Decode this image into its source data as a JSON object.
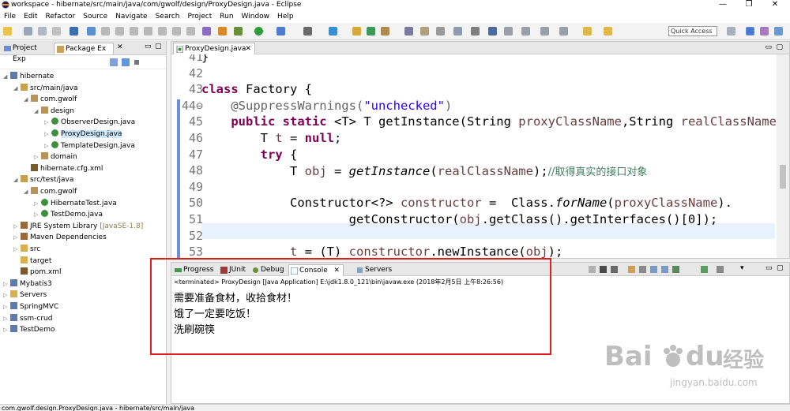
{
  "window": {
    "title": "workspace - hibernate/src/main/java/com/gwolf/design/ProxyDesign.java - Eclipse",
    "minimize": "—",
    "restore": "❐",
    "close": "✕"
  },
  "menu": [
    "File",
    "Edit",
    "Refactor",
    "Source",
    "Navigate",
    "Search",
    "Project",
    "Run",
    "Window",
    "Help"
  ],
  "quick_access": "Quick Access",
  "left_tabs": {
    "project_explorer": "Project Exp",
    "package_explorer": "Package Ex"
  },
  "tree": [
    {
      "label": "hibernate",
      "indent": 0,
      "arrow": "◢",
      "icon": "project"
    },
    {
      "label": "src/main/java",
      "indent": 1,
      "arrow": "◢",
      "icon": "srcfolder"
    },
    {
      "label": "com.gwolf",
      "indent": 2,
      "arrow": "◢",
      "icon": "package"
    },
    {
      "label": "design",
      "indent": 3,
      "arrow": "◢",
      "icon": "package"
    },
    {
      "label": "ObserverDesign.java",
      "indent": 4,
      "arrow": "▷",
      "icon": "java"
    },
    {
      "label": "ProxyDesign.java",
      "indent": 4,
      "arrow": "▷",
      "icon": "java",
      "selected": true
    },
    {
      "label": "TemplateDesign.java",
      "indent": 4,
      "arrow": "▷",
      "icon": "java"
    },
    {
      "label": "domain",
      "indent": 3,
      "arrow": "▷",
      "icon": "package"
    },
    {
      "label": "hibernate.cfg.xml",
      "indent": 2,
      "arrow": "",
      "icon": "xml"
    },
    {
      "label": "src/test/java",
      "indent": 1,
      "arrow": "◢",
      "icon": "srcfolder"
    },
    {
      "label": "com.gwolf",
      "indent": 2,
      "arrow": "◢",
      "icon": "package"
    },
    {
      "label": "HibernateTest.java",
      "indent": 3,
      "arrow": "▷",
      "icon": "java"
    },
    {
      "label": "TestDemo.java",
      "indent": 3,
      "arrow": "▷",
      "icon": "java"
    },
    {
      "label": "JRE System Library",
      "deco": "[JavaSE-1.8]",
      "indent": 1,
      "arrow": "▷",
      "icon": "library"
    },
    {
      "label": "Maven Dependencies",
      "indent": 1,
      "arrow": "▷",
      "icon": "library"
    },
    {
      "label": "src",
      "indent": 1,
      "arrow": "▷",
      "icon": "folder"
    },
    {
      "label": "target",
      "indent": 1,
      "arrow": "",
      "icon": "folder"
    },
    {
      "label": "pom.xml",
      "indent": 1,
      "arrow": "",
      "icon": "xml"
    },
    {
      "label": "Mybatis3",
      "indent": 0,
      "arrow": "▷",
      "icon": "project"
    },
    {
      "label": "Servers",
      "indent": 0,
      "arrow": "▷",
      "icon": "folder"
    },
    {
      "label": "SpringMVC",
      "indent": 0,
      "arrow": "▷",
      "icon": "project"
    },
    {
      "label": "ssm-crud",
      "indent": 0,
      "arrow": "▷",
      "icon": "project"
    },
    {
      "label": "TestDemo",
      "indent": 0,
      "arrow": "▷",
      "icon": "project"
    }
  ],
  "editor": {
    "tab": "ProxyDesign.java",
    "lines": [
      {
        "n": "41",
        "segs": [
          [
            "",
            "}"
          ]
        ]
      },
      {
        "n": "42",
        "segs": []
      },
      {
        "n": "43",
        "segs": [
          [
            "kw",
            "class"
          ],
          [
            "",
            " Factory {"
          ]
        ]
      },
      {
        "n": "44⊖",
        "segs": [
          [
            "",
            "    "
          ],
          [
            "ann",
            "@SuppressWarnings("
          ],
          [
            "str",
            "\"unchecked\""
          ],
          [
            "ann",
            ")"
          ]
        ]
      },
      {
        "n": "45",
        "segs": [
          [
            "",
            "    "
          ],
          [
            "kw",
            "public static"
          ],
          [
            "",
            " <T> T getInstance(String "
          ],
          [
            "var",
            "proxyClassName"
          ],
          [
            "",
            ",String "
          ],
          [
            "var",
            "realClassName"
          ],
          [
            "",
            ")"
          ]
        ]
      },
      {
        "n": "46",
        "segs": [
          [
            "",
            "        T "
          ],
          [
            "var",
            "t"
          ],
          [
            "",
            " = "
          ],
          [
            "kw",
            "null"
          ],
          [
            "",
            ";"
          ]
        ]
      },
      {
        "n": "47",
        "segs": [
          [
            "",
            "        "
          ],
          [
            "kw",
            "try"
          ],
          [
            "",
            " {"
          ]
        ]
      },
      {
        "n": "48",
        "segs": [
          [
            "",
            "            T "
          ],
          [
            "var",
            "obj"
          ],
          [
            "",
            " = "
          ],
          [
            "it",
            "getInstance"
          ],
          [
            "",
            "("
          ],
          [
            "var",
            "realClassName"
          ],
          [
            "",
            ");"
          ],
          [
            "cmt",
            "//取得真实的接口对象"
          ]
        ]
      },
      {
        "n": "49",
        "segs": []
      },
      {
        "n": "50",
        "segs": [
          [
            "",
            "            Constructor<?> "
          ],
          [
            "var",
            "constructor"
          ],
          [
            "",
            " =  Class."
          ],
          [
            "it",
            "forName"
          ],
          [
            "",
            "("
          ],
          [
            "var",
            "proxyClassName"
          ],
          [
            "",
            ")."
          ]
        ]
      },
      {
        "n": "51",
        "segs": [
          [
            "",
            "                    getConstructor("
          ],
          [
            "var",
            "obj"
          ],
          [
            "",
            ".getClass().getInterfaces()[0]);"
          ]
        ]
      },
      {
        "n": "52",
        "segs": []
      },
      {
        "n": "53",
        "segs": [
          [
            "",
            "            "
          ],
          [
            "var",
            "t"
          ],
          [
            "",
            " = (T) "
          ],
          [
            "var",
            "constructor"
          ],
          [
            "",
            ".newInstance("
          ],
          [
            "var",
            "obj"
          ],
          [
            "",
            ");"
          ]
        ]
      }
    ]
  },
  "console": {
    "tabs": [
      "Progress",
      "JUnit",
      "Debug",
      "Console",
      "Servers"
    ],
    "status": "<terminated> ProxyDesign [Java Application] E:\\jdk1.8.0_121\\bin\\javaw.exe (2018年2月5日 上午8:26:56)",
    "output": [
      "需要准备食材，收拾食材！",
      "饿了一定要吃饭！",
      "洗刷碗筷"
    ]
  },
  "statusbar": "com.gwolf.design.ProxyDesign.java - hibernate/src/main/java",
  "watermark": {
    "brand": "Bai",
    "du": "du",
    "cn": "经验",
    "url": "jingyan.baidu.com"
  },
  "colors": {
    "keyword": "#7f0055",
    "string": "#2a00ff",
    "variable": "#6a3e3e",
    "comment": "#3f7f5f",
    "highlight_box": "#e01e1e",
    "selection": "#cde8ff"
  }
}
